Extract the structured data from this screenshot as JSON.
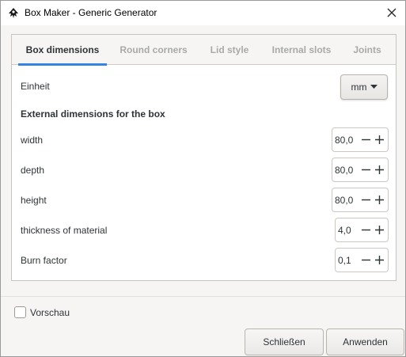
{
  "window": {
    "title": "Box Maker - Generic Generator"
  },
  "tabs": [
    {
      "label": "Box dimensions",
      "active": true
    },
    {
      "label": "Round corners",
      "active": false
    },
    {
      "label": "Lid style",
      "active": false
    },
    {
      "label": "Internal slots",
      "active": false
    },
    {
      "label": "Joints",
      "active": false
    }
  ],
  "unit": {
    "label": "Einheit",
    "value": "mm"
  },
  "section_heading": "External dimensions for the box",
  "fields": [
    {
      "label": "width",
      "value": "80,0"
    },
    {
      "label": "depth",
      "value": "80,0"
    },
    {
      "label": "height",
      "value": "80,0"
    },
    {
      "label": "thickness of material",
      "value": "4,0"
    },
    {
      "label": "Burn factor",
      "value": "0,1"
    }
  ],
  "preview": {
    "label": "Vorschau",
    "checked": false
  },
  "buttons": {
    "close": "Schließen",
    "apply": "Anwenden"
  },
  "colors": {
    "accent": "#3584e4",
    "text": "#2e3436",
    "inactive_tab": "#a9a9a7"
  },
  "icons": {
    "app": "inkscape-icon",
    "close": "close-icon",
    "dropdown": "triangle-down-icon",
    "minus": "minus-icon",
    "plus": "plus-icon"
  }
}
